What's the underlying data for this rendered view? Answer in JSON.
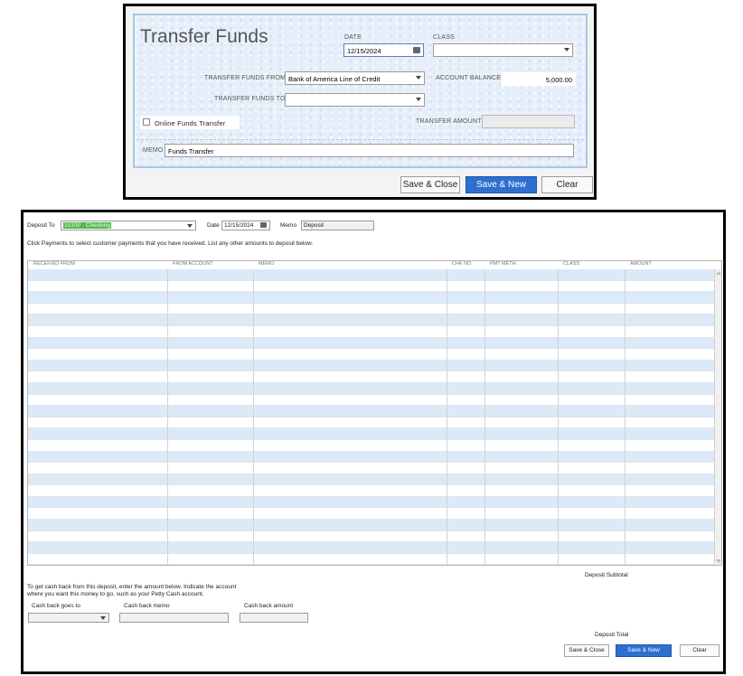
{
  "transfer_funds": {
    "title": "Transfer Funds",
    "date_label": "DATE",
    "date_value": "12/15/2024",
    "class_label": "CLASS",
    "class_value": "",
    "from_label": "TRANSFER FUNDS FROM",
    "from_value": "Bank of America Line of Credit",
    "balance_label": "ACCOUNT BALANCE",
    "balance_value": "5,000.00",
    "to_label": "TRANSFER FUNDS TO",
    "to_value": "",
    "online_label": "Online Funds Transfer",
    "amount_label": "TRANSFER AMOUNT",
    "amount_value": "",
    "memo_label": "MEMO",
    "memo_value": "Funds Transfer",
    "buttons": {
      "save_close": "Save & Close",
      "save_new": "Save & New",
      "clear": "Clear"
    }
  },
  "make_deposits": {
    "deposit_to_label": "Deposit To",
    "deposit_to_value": "10100 · Checking",
    "date_label": "Date",
    "date_value": "12/15/2024",
    "memo_label": "Memo",
    "memo_value": "Deposit",
    "instructions": "Click Payments to select customer payments that you have received. List any other amounts to deposit below.",
    "columns": [
      "RECEIVED FROM",
      "FROM ACCOUNT",
      "MEMO",
      "CHK NO.",
      "PMT METH.",
      "CLASS",
      "AMOUNT"
    ],
    "deposit_subtotal_label": "Deposit Subtotal",
    "cashback_text_1": "To get cash back from this deposit, enter the amount below.  Indicate the account",
    "cashback_text_2": "where you want this money to go, such as your Petty Cash account.",
    "cash_back_goes_to_label": "Cash back goes to",
    "cash_back_memo_label": "Cash back memo",
    "cash_back_amount_label": "Cash back amount",
    "deposit_total_label": "Deposit Total",
    "buttons": {
      "save_close": "Save & Close",
      "save_new": "Save & New",
      "clear": "Clear"
    }
  }
}
